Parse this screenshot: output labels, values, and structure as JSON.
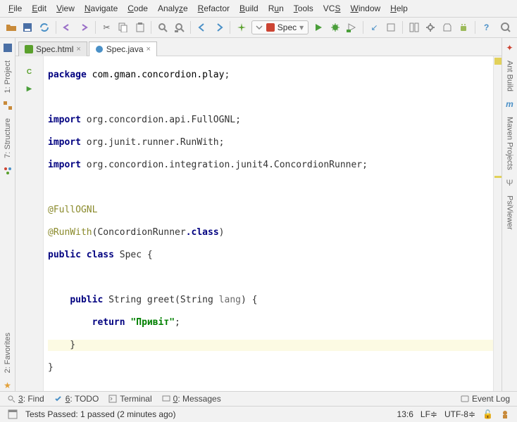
{
  "menu": {
    "file": "File",
    "edit": "Edit",
    "view": "View",
    "navigate": "Navigate",
    "code": "Code",
    "analyze": "Analyze",
    "refactor": "Refactor",
    "build": "Build",
    "run": "Run",
    "tools": "Tools",
    "vcs": "VCS",
    "window": "Window",
    "help": "Help",
    "underlines": {
      "file": "F",
      "edit": "E",
      "view": "V",
      "navigate": "N",
      "code": "C",
      "analyze": "z",
      "refactor": "R",
      "build": "B",
      "run": "u",
      "tools": "T",
      "vcs": "S",
      "window": "W",
      "help": "H"
    }
  },
  "toolbar": {
    "run_config_label": "Spec"
  },
  "tabs": {
    "items": [
      {
        "label": "Spec.html",
        "active": false,
        "icon": "html"
      },
      {
        "label": "Spec.java",
        "active": true,
        "icon": "java"
      }
    ]
  },
  "tool_windows": {
    "left": [
      {
        "label": "1: Project",
        "icon": "project"
      },
      {
        "label": "7: Structure",
        "icon": "structure"
      },
      {
        "label": "2: Favorites",
        "icon": "favorites"
      }
    ],
    "right": [
      {
        "label": "Ant Build",
        "icon": "ant"
      },
      {
        "label": "Maven Projects",
        "icon": "maven"
      },
      {
        "label": "PsiViewer",
        "icon": "psi"
      }
    ]
  },
  "code": {
    "package_kw": "package",
    "package_name": "com.gman.concordion.play",
    "import_kw": "import",
    "imports": [
      "org.concordion.api.FullOGNL",
      "org.junit.runner.RunWith",
      "org.concordion.integration.junit4.ConcordionRunner"
    ],
    "ann_fullognl": "@FullOGNL",
    "ann_runwith": "@RunWith",
    "runwith_arg_cls": "ConcordionRunner",
    "class_kw": "class",
    "public_kw": "public",
    "class_name": "Spec",
    "method_ret": "String",
    "method_name": "greet",
    "method_param_type": "String",
    "method_param_name": "lang",
    "return_kw": "return",
    "return_value": "\"Привіт\"",
    "dot_class": ".class"
  },
  "bottom": {
    "find": "3: Find",
    "todo": "6: TODO",
    "terminal": "Terminal",
    "messages": "0: Messages",
    "eventlog": "Event Log"
  },
  "status": {
    "text": "Tests Passed: 1 passed (2 minutes ago)",
    "linecol": "13:6",
    "lineend": "LF",
    "encoding": "UTF-8"
  }
}
